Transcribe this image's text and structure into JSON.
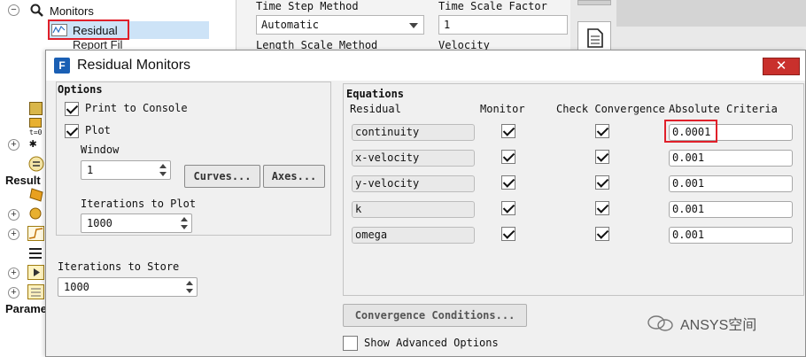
{
  "tree": {
    "monitors_label": "Monitors",
    "residual_label": "Residual",
    "report_file_label": "Report Fil",
    "t0_label": "t=0",
    "results_label": "Result",
    "params_label": "Parame"
  },
  "bg_panel": {
    "time_step_method_label": "Time Step Method",
    "time_step_method_value": "Automatic",
    "time_scale_factor_label": "Time Scale Factor",
    "time_scale_factor_value": "1",
    "length_scale_method_label": "Length Scale Method",
    "velocity_label": "Velocity"
  },
  "dialog": {
    "title": "Residual Monitors",
    "close_symbol": "✕",
    "options": {
      "title": "Options",
      "print_to_console": "Print to Console",
      "print_to_console_checked": true,
      "plot": "Plot",
      "plot_checked": true,
      "window_label": "Window",
      "window_value": "1",
      "curves_button": "Curves...",
      "axes_button": "Axes...",
      "iterations_to_plot_label": "Iterations to Plot",
      "iterations_to_plot_value": "1000"
    },
    "iterations_to_store_label": "Iterations to Store",
    "iterations_to_store_value": "1000",
    "equations": {
      "title": "Equations",
      "headers": {
        "residual": "Residual",
        "monitor": "Monitor",
        "check_convergence": "Check Convergence",
        "absolute_criteria": "Absolute Criteria"
      },
      "rows": [
        {
          "name": "continuity",
          "monitor": true,
          "check": true,
          "criteria": "0.0001"
        },
        {
          "name": "x-velocity",
          "monitor": true,
          "check": true,
          "criteria": "0.001"
        },
        {
          "name": "y-velocity",
          "monitor": true,
          "check": true,
          "criteria": "0.001"
        },
        {
          "name": "k",
          "monitor": true,
          "check": true,
          "criteria": "0.001"
        },
        {
          "name": "omega",
          "monitor": true,
          "check": true,
          "criteria": "0.001"
        }
      ]
    },
    "convergence_conditions_button": "Convergence Conditions...",
    "show_advanced_options": "Show Advanced Options",
    "show_advanced_options_checked": false
  },
  "watermark": "ANSYS空间",
  "colors": {
    "highlight_red": "#e0202a",
    "selection_blue": "#cde3f7"
  }
}
